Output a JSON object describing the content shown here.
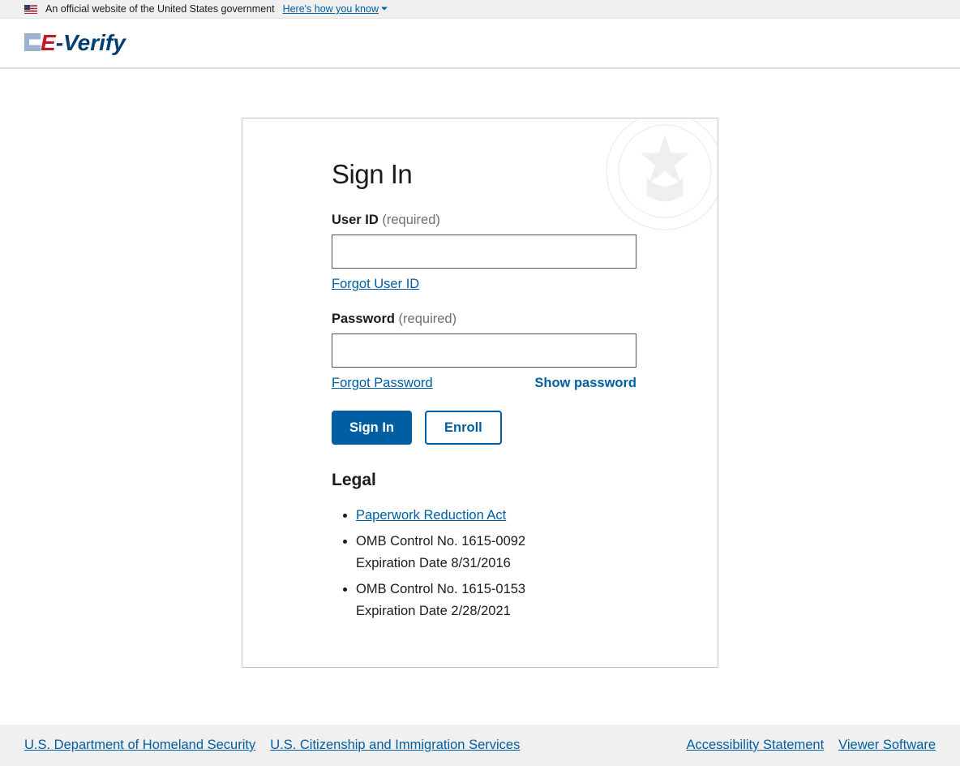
{
  "banner": {
    "text": "An official website of the United States government",
    "link": "Here's how you know"
  },
  "logo": {
    "e": "E",
    "dash": "-",
    "verify": "Verify"
  },
  "card": {
    "title": "Sign In",
    "userid_label": "User ID",
    "userid_req": "(required)",
    "forgot_userid": "Forgot User ID",
    "password_label": "Password",
    "password_req": "(required)",
    "forgot_password": "Forgot Password",
    "show_password": "Show password",
    "signin_btn": "Sign In",
    "enroll_btn": "Enroll",
    "legal_heading": "Legal",
    "legal": {
      "paperwork": "Paperwork Reduction Act",
      "omb1_line1": "OMB Control No. 1615-0092",
      "omb1_line2": "Expiration Date 8/31/2016",
      "omb2_line1": "OMB Control No. 1615-0153",
      "omb2_line2": "Expiration Date 2/28/2021"
    }
  },
  "footer": {
    "dhs": "U.S. Department of Homeland Security",
    "uscis": "U.S. Citizenship and Immigration Services",
    "accessibility": "Accessibility Statement",
    "viewer": "Viewer Software"
  }
}
